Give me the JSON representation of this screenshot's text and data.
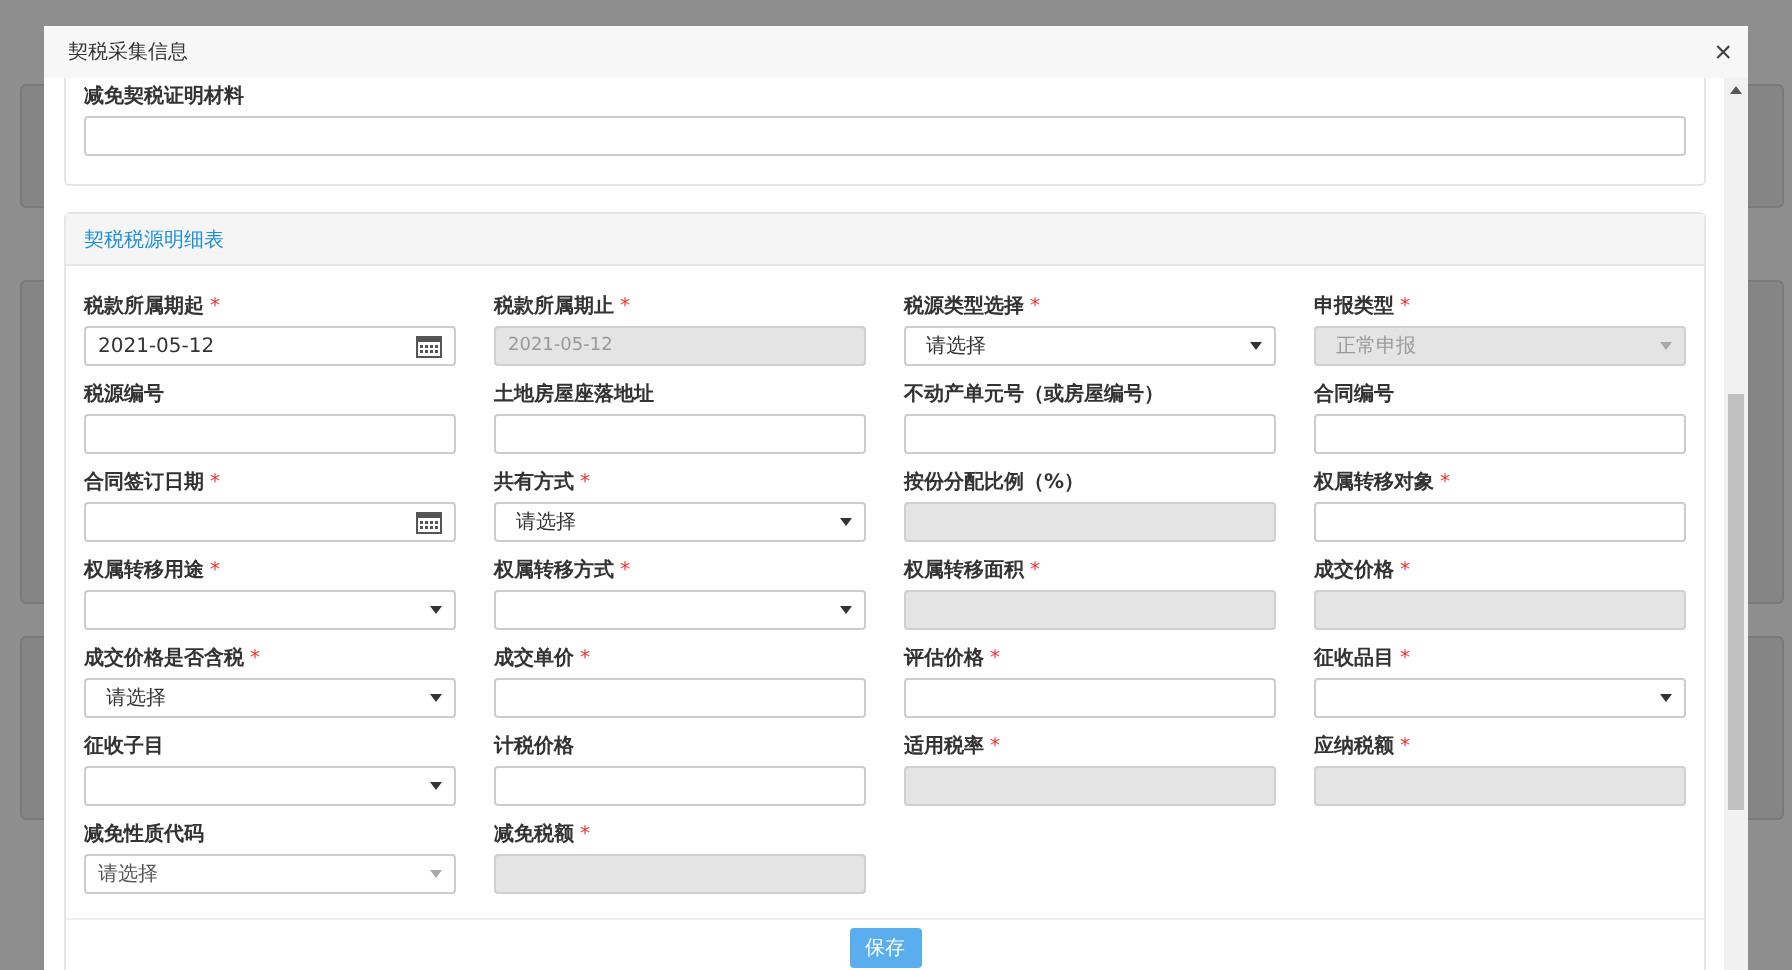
{
  "dialog": {
    "title": "契税采集信息",
    "close": "×"
  },
  "proof_section": {
    "label": "减免契税证明材料"
  },
  "detail_section": {
    "title": "契税税源明细表",
    "fields": [
      {
        "label": "税款所属期起",
        "required_mark": "*",
        "kind": "date",
        "value": "2021-05-12",
        "disabled": false
      },
      {
        "label": "税款所属期止",
        "required_mark": "*",
        "kind": "text",
        "value": "2021-05-12",
        "disabled": true
      },
      {
        "label": "税源类型选择",
        "required_mark": "*",
        "kind": "select",
        "value": "请选择",
        "disabled": false
      },
      {
        "label": "申报类型",
        "required_mark": "*",
        "kind": "select",
        "value": "正常申报",
        "disabled": true
      },
      {
        "label": "税源编号",
        "kind": "text",
        "disabled": false
      },
      {
        "label": "土地房屋座落地址",
        "kind": "text",
        "disabled": false
      },
      {
        "label": "不动产单元号（或房屋编号）",
        "kind": "text",
        "disabled": false
      },
      {
        "label": "合同编号",
        "kind": "text",
        "disabled": false
      },
      {
        "label": "合同签订日期",
        "required_mark": "*",
        "kind": "date",
        "disabled": false
      },
      {
        "label": "共有方式",
        "required_mark": "*",
        "kind": "select",
        "value": "请选择",
        "disabled": false
      },
      {
        "label": "按份分配比例（%）",
        "kind": "text",
        "disabled": true
      },
      {
        "label": "权属转移对象",
        "required_mark": "*",
        "kind": "text",
        "disabled": false
      },
      {
        "label": "权属转移用途",
        "required_mark": "*",
        "kind": "select",
        "disabled": false
      },
      {
        "label": "权属转移方式",
        "required_mark": "*",
        "kind": "select",
        "disabled": false
      },
      {
        "label": "权属转移面积",
        "required_mark": "*",
        "kind": "text",
        "disabled": true
      },
      {
        "label": "成交价格",
        "required_mark": "*",
        "kind": "text",
        "disabled": true
      },
      {
        "label": "成交价格是否含税",
        "required_mark": "*",
        "kind": "select",
        "value": "请选择",
        "disabled": false
      },
      {
        "label": "成交单价",
        "required_mark": "*",
        "kind": "text",
        "disabled": false
      },
      {
        "label": "评估价格",
        "required_mark": "*",
        "kind": "text",
        "disabled": false
      },
      {
        "label": "征收品目",
        "required_mark": "*",
        "kind": "select",
        "disabled": false
      },
      {
        "label": "征收子目",
        "kind": "select",
        "disabled": false
      },
      {
        "label": "计税价格",
        "kind": "text",
        "disabled": false
      },
      {
        "label": "适用税率",
        "required_mark": "*",
        "kind": "text",
        "disabled": true
      },
      {
        "label": "应纳税额",
        "required_mark": "*",
        "kind": "text",
        "disabled": true
      },
      {
        "label": "减免性质代码",
        "kind": "select2",
        "value": "请选择",
        "disabled": false
      },
      {
        "label": "减免税额",
        "required_mark": "*",
        "kind": "text",
        "disabled": true
      }
    ],
    "save_button": "保存"
  }
}
